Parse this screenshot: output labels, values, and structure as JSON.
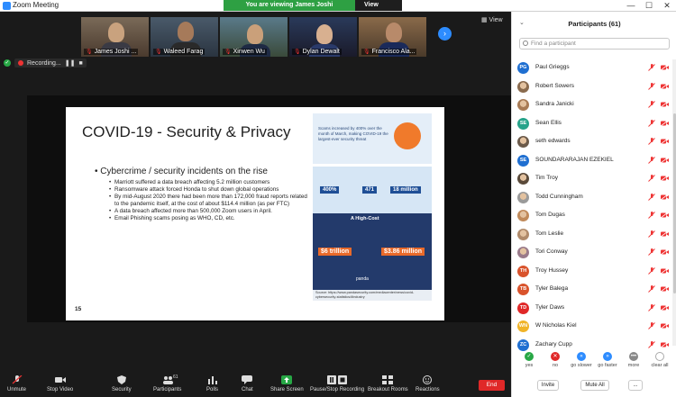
{
  "window": {
    "title": "Zoom Meeting",
    "minimize": "—",
    "maximize": "☐",
    "close": "✕"
  },
  "share_banner": {
    "text": "You are viewing James Joshi NSF/Pitt's screen",
    "options": "View Options ▾"
  },
  "view_button": "▦ View",
  "recording": {
    "label": "Recording...",
    "pause": "❚❚",
    "stop": "■"
  },
  "thumbnails": [
    {
      "name": "James Joshi ...",
      "muted": true
    },
    {
      "name": "Waleed Farag",
      "muted": true
    },
    {
      "name": "Xinwen Wu",
      "muted": true
    },
    {
      "name": "Dylan Dewalt",
      "muted": true
    },
    {
      "name": "Francisco Ala...",
      "muted": true
    }
  ],
  "slide": {
    "title": "COVID-19 - Security & Privacy",
    "bullet": "Cybercrime / security incidents on the rise",
    "sub_bullets": [
      "Marriott suffered a data breach affecting 5.2 million customers",
      "Ransomware attack forced Honda to shut down global operations",
      "By mid-August 2020 there had been more than 172,000 fraud reports related to the pandemic itself, at the cost of about $114.4 million (as per FTC)",
      "A data breach affected more than 500,000 Zoom users in April.",
      "Email Phishing scams posing as WHO, CD, etc."
    ],
    "page_number": "15",
    "infographic": {
      "top_text": "Scams increased by 400% over the month of March, making COVID-19 the largest-ever security threat",
      "stat1": "400%",
      "stat2": "471",
      "stat3": "18 million",
      "section_title": "A High-Cost",
      "cost1": "$6 trillion",
      "cost2": "$3.86 million",
      "brand": "panda",
      "source": "Source: https://www.pandasecurity.com/mediacenter/news/covid-cybersecurity-statistics/#industry"
    }
  },
  "toolbar": {
    "unmute": "Unmute",
    "stop_video": "Stop Video",
    "security": "Security",
    "participants": "Participants",
    "participants_count": "61",
    "polls": "Polls",
    "chat": "Chat",
    "share_screen": "Share Screen",
    "pause_recording": "Pause/Stop Recording",
    "breakout_rooms": "Breakout Rooms",
    "reactions": "Reactions",
    "end": "End"
  },
  "panel": {
    "title": "Participants (61)",
    "search_placeholder": "Find a participant",
    "participants": [
      {
        "name": "Paul Grieggs",
        "initials": "PG",
        "color": "#1f6fd1",
        "photo": false
      },
      {
        "name": "Robert Sowers",
        "initials": "",
        "color": "#8a6b4e",
        "photo": true
      },
      {
        "name": "Sandra Janicki",
        "initials": "",
        "color": "#a87b55",
        "photo": true
      },
      {
        "name": "Sean Ellis",
        "initials": "SE",
        "color": "#27a38a",
        "photo": false
      },
      {
        "name": "seth edwards",
        "initials": "",
        "color": "#6b5a4a",
        "photo": true
      },
      {
        "name": "SOUNDARARAJAN EZEKIEL",
        "initials": "SE",
        "color": "#1f6fd1",
        "photo": false
      },
      {
        "name": "Tim Troy",
        "initials": "",
        "color": "#5a4a3a",
        "photo": true
      },
      {
        "name": "Todd Cunningham",
        "initials": "",
        "color": "#9a9a9a",
        "photo": true
      },
      {
        "name": "Tom Dugas",
        "initials": "",
        "color": "#c08a5a",
        "photo": true
      },
      {
        "name": "Tom Leslie",
        "initials": "",
        "color": "#b08a6a",
        "photo": true
      },
      {
        "name": "Tori Conway",
        "initials": "",
        "color": "#9a7a8a",
        "photo": true
      },
      {
        "name": "Troy Hussey",
        "initials": "TH",
        "color": "#d9532c",
        "photo": false
      },
      {
        "name": "Tyler Balega",
        "initials": "TB",
        "color": "#d9532c",
        "photo": false
      },
      {
        "name": "Tyler Daws",
        "initials": "TD",
        "color": "#e02828",
        "photo": false
      },
      {
        "name": "W Nicholas Kiel",
        "initials": "WN",
        "color": "#f0b429",
        "photo": false
      },
      {
        "name": "Zachary Cupp",
        "initials": "ZC",
        "color": "#1f6fd1",
        "photo": false
      }
    ],
    "reactions": [
      {
        "label": "yes",
        "glyph": "✓",
        "color": "#27a745"
      },
      {
        "label": "no",
        "glyph": "✕",
        "color": "#e02828"
      },
      {
        "label": "go slower",
        "glyph": "«",
        "color": "#2d8cff"
      },
      {
        "label": "go faster",
        "glyph": "»",
        "color": "#2d8cff"
      },
      {
        "label": "more",
        "glyph": "•••",
        "color": "#888888"
      },
      {
        "label": "clear all",
        "glyph": "",
        "color": "#ffffff"
      }
    ],
    "invite": "Invite",
    "mute_all": "Mute All",
    "more": "..."
  }
}
